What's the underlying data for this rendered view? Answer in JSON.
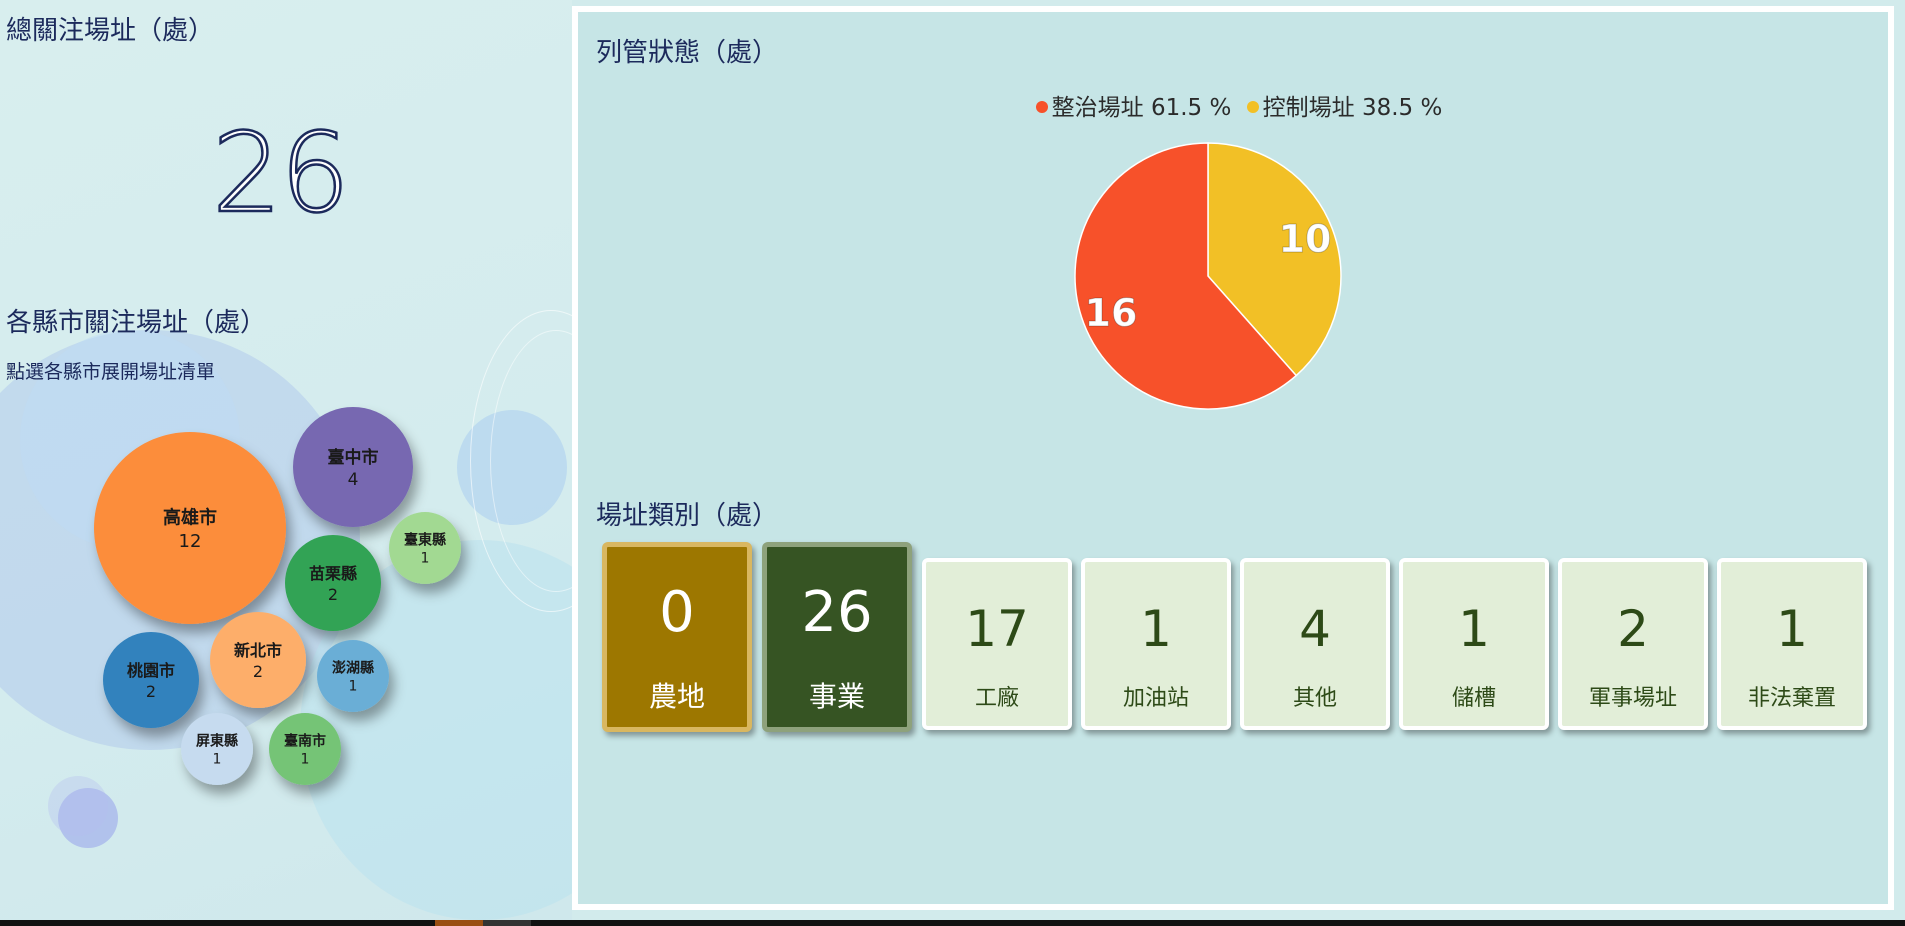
{
  "left": {
    "total_title": "總關注場址（處）",
    "total_value": "26",
    "county_title": "各縣市關注場址（處）",
    "county_subtitle": "點選各縣市展開場址清單",
    "bubbles": [
      {
        "name": "高雄市",
        "count": "12",
        "color": "#fc8d3b"
      },
      {
        "name": "臺中市",
        "count": "4",
        "color": "#7768b1"
      },
      {
        "name": "臺東縣",
        "count": "1",
        "color": "#a2d992"
      },
      {
        "name": "苗栗縣",
        "count": "2",
        "color": "#31a354"
      },
      {
        "name": "桃園市",
        "count": "2",
        "color": "#3182bd"
      },
      {
        "name": "新北市",
        "count": "2",
        "color": "#fdae6b"
      },
      {
        "name": "澎湖縣",
        "count": "1",
        "color": "#6baed6"
      },
      {
        "name": "屏東縣",
        "count": "1",
        "color": "#c6dbef"
      },
      {
        "name": "臺南市",
        "count": "1",
        "color": "#74c476"
      }
    ]
  },
  "status": {
    "title": "列管狀態（處）",
    "legend": [
      {
        "label": "整治場址 61.5 %",
        "color": "#f7512a"
      },
      {
        "label": "控制場址 38.5 %",
        "color": "#f2c026"
      }
    ]
  },
  "chart_data": {
    "type": "pie",
    "slices": [
      {
        "name": "整治場址",
        "value": 16,
        "percent": 61.5,
        "color": "#f7512a"
      },
      {
        "name": "控制場址",
        "value": 10,
        "percent": 38.5,
        "color": "#f2c026"
      }
    ]
  },
  "types": {
    "title": "場址類別（處）",
    "cards": [
      {
        "value": "0",
        "label": "農地"
      },
      {
        "value": "26",
        "label": "事業"
      },
      {
        "value": "17",
        "label": "工廠"
      },
      {
        "value": "1",
        "label": "加油站"
      },
      {
        "value": "4",
        "label": "其他"
      },
      {
        "value": "1",
        "label": "儲槽"
      },
      {
        "value": "2",
        "label": "軍事場址"
      },
      {
        "value": "1",
        "label": "非法棄置"
      }
    ]
  }
}
